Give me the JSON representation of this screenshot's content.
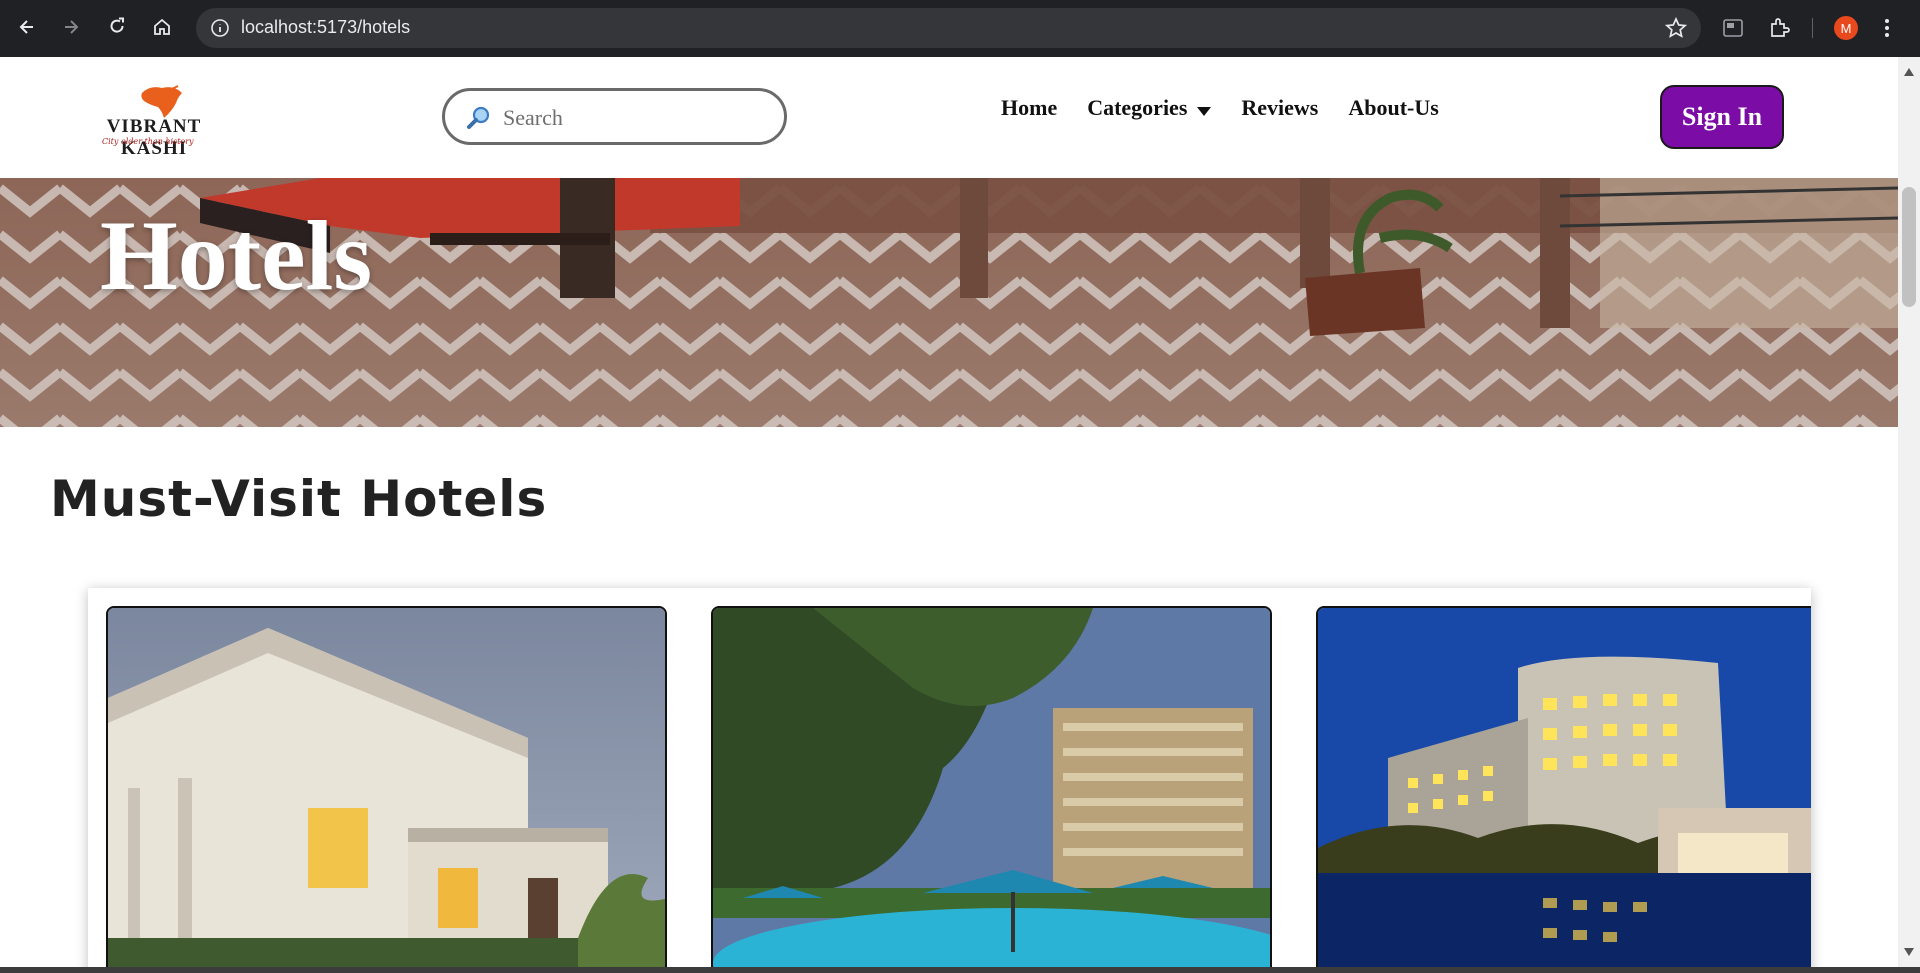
{
  "browser": {
    "url": "localhost:5173/hotels",
    "profile_initial": "M",
    "icons": [
      "back-icon",
      "forward-icon",
      "reload-icon",
      "home-icon",
      "info-icon",
      "star-icon",
      "extension-icon",
      "puzzle-icon",
      "menu-icon"
    ]
  },
  "header": {
    "logo": {
      "brand": "VIBRANT KASHI",
      "tagline": "City older than history"
    },
    "search": {
      "placeholder": "Search",
      "value": ""
    },
    "nav": {
      "home": "Home",
      "categories": "Categories",
      "reviews": "Reviews",
      "about": "About-Us"
    },
    "signin": "Sign In"
  },
  "hero": {
    "title": "Hotels"
  },
  "section": {
    "title": "Must-Visit Hotels"
  },
  "cards": [
    {
      "image": "colonial-white-hotel-photo"
    },
    {
      "image": "hotel-pool-umbrellas-photo"
    },
    {
      "image": "hotel-night-lights-photo"
    }
  ],
  "colors": {
    "signin_bg": "#7b0da6",
    "chrome_bg": "#202124",
    "logo_orange": "#e8601c"
  }
}
